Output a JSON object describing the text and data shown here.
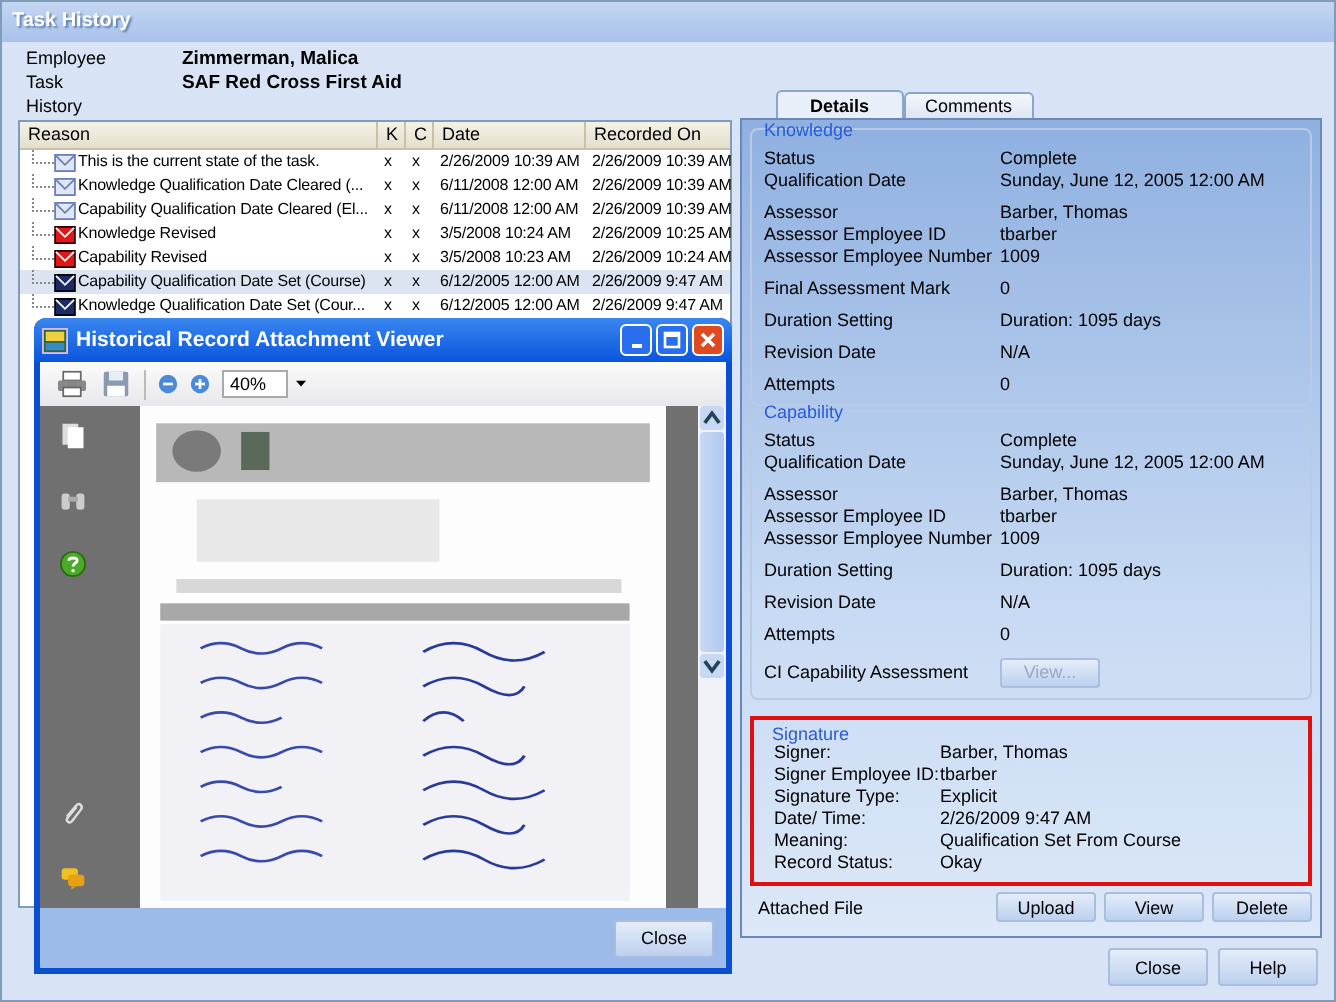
{
  "window": {
    "title": "Task History"
  },
  "info": [
    {
      "label": "Employee",
      "value": "Zimmerman, Malica"
    },
    {
      "label": "Task",
      "value": "SAF  Red Cross First Aid"
    }
  ],
  "history": {
    "label": "History",
    "columns": [
      "Reason",
      "K",
      "C",
      "Date",
      "Recorded On"
    ],
    "rows": [
      {
        "kind": "info",
        "reason": "This is the current state of the task.",
        "k": "x",
        "c": "x",
        "date": "2/26/2009 10:39 AM",
        "recorded": "2/26/2009 10:39 AM",
        "selected": false
      },
      {
        "kind": "info",
        "reason": "Knowledge Qualification Date Cleared (...",
        "k": "x",
        "c": "x",
        "date": "6/11/2008 12:00 AM",
        "recorded": "2/26/2009 10:39 AM",
        "selected": false
      },
      {
        "kind": "info",
        "reason": "Capability Qualification Date Cleared (El...",
        "k": "x",
        "c": "x",
        "date": "6/11/2008 12:00 AM",
        "recorded": "2/26/2009 10:39 AM",
        "selected": false
      },
      {
        "kind": "revised",
        "reason": "Knowledge Revised",
        "k": "x",
        "c": "x",
        "date": "3/5/2008 10:24 AM",
        "recorded": "2/26/2009 10:25 AM",
        "selected": false
      },
      {
        "kind": "revised",
        "reason": "Capability Revised",
        "k": "x",
        "c": "x",
        "date": "3/5/2008 10:23 AM",
        "recorded": "2/26/2009 10:24 AM",
        "selected": false
      },
      {
        "kind": "set",
        "reason": "Capability Qualification Date Set (Course)",
        "k": "x",
        "c": "x",
        "date": "6/12/2005 12:00 AM",
        "recorded": "2/26/2009 9:47 AM",
        "selected": true
      },
      {
        "kind": "set",
        "reason": "Knowledge Qualification Date Set (Cour...",
        "k": "x",
        "c": "x",
        "date": "6/12/2005 12:00 AM",
        "recorded": "2/26/2009 9:47 AM",
        "selected": false
      }
    ]
  },
  "viewer": {
    "title": "Historical Record Attachment Viewer",
    "zoom": "40%",
    "button": "Close"
  },
  "tabs": [
    {
      "label": "Details",
      "selected": true
    },
    {
      "label": "Comments",
      "selected": false
    }
  ],
  "sections": [
    {
      "title": "Knowledge",
      "highlighted": false,
      "groups": [
        [
          {
            "label": "Status",
            "value": "Complete"
          },
          {
            "label": "Qualification Date",
            "value": "Sunday, June 12, 2005 12:00 AM"
          }
        ],
        [
          {
            "label": "Assessor",
            "value": "Barber, Thomas"
          },
          {
            "label": "Assessor Employee ID",
            "value": "tbarber"
          },
          {
            "label": "Assessor Employee Number",
            "value": "1009"
          }
        ],
        [
          {
            "label": "Final Assessment Mark",
            "value": "0"
          }
        ],
        [
          {
            "label": "Duration Setting",
            "value": "Duration: 1095 days"
          }
        ],
        [
          {
            "label": "Revision Date",
            "value": "N/A"
          }
        ],
        [
          {
            "label": "Attempts",
            "value": "0"
          }
        ]
      ]
    },
    {
      "title": "Capability",
      "highlighted": false,
      "groups": [
        [
          {
            "label": "Status",
            "value": "Complete"
          },
          {
            "label": "Qualification Date",
            "value": "Sunday, June 12, 2005 12:00 AM"
          }
        ],
        [
          {
            "label": "Assessor",
            "value": "Barber, Thomas"
          },
          {
            "label": "Assessor Employee ID",
            "value": "tbarber"
          },
          {
            "label": "Assessor Employee Number",
            "value": "1009"
          }
        ],
        [
          {
            "label": "Duration Setting",
            "value": "Duration: 1095 days"
          }
        ],
        [
          {
            "label": "Revision Date",
            "value": "N/A"
          }
        ],
        [
          {
            "label": "Attempts",
            "value": "0"
          }
        ],
        [
          {
            "label": "CI Capability Assessment",
            "button": "View...",
            "disabled": true
          }
        ]
      ]
    },
    {
      "title": "Signature",
      "highlighted": true,
      "groups": [
        [
          {
            "label": "Signer:",
            "value": "Barber, Thomas"
          },
          {
            "label": "Signer Employee ID:",
            "value": "tbarber"
          },
          {
            "label": "Signature Type:",
            "value": "Explicit"
          },
          {
            "label": "Date/ Time:",
            "value": "2/26/2009 9:47 AM"
          },
          {
            "label": "Meaning:",
            "value": "Qualification Set From Course"
          },
          {
            "label": "Record Status:",
            "value": "Okay"
          }
        ]
      ]
    }
  ],
  "attached_file": {
    "label": "Attached File",
    "buttons": [
      "Upload",
      "View",
      "Delete"
    ]
  },
  "buttons": [
    "Close",
    "Help"
  ]
}
